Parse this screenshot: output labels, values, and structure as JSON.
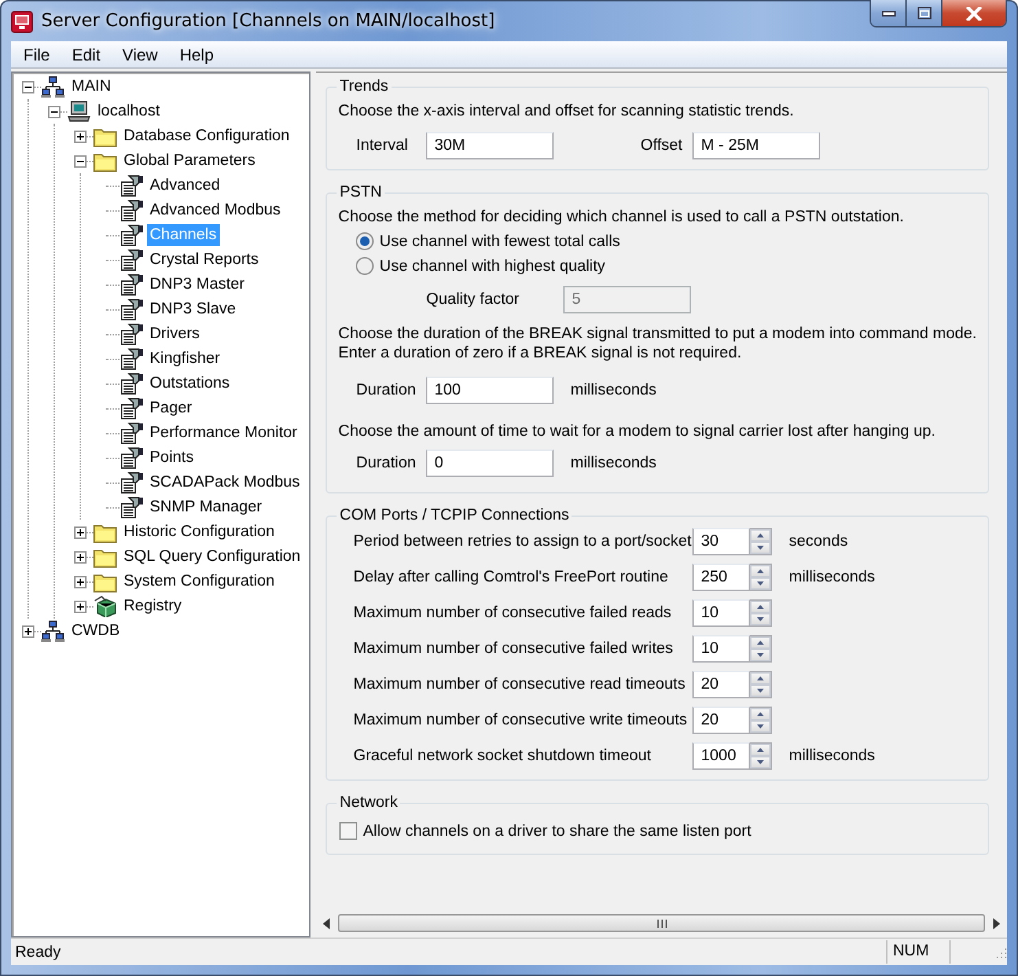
{
  "window": {
    "title": "Server Configuration [Channels on MAIN/localhost]"
  },
  "menu": [
    "File",
    "Edit",
    "View",
    "Help"
  ],
  "tree": [
    {
      "label": "MAIN",
      "kind": "network",
      "expanded": true,
      "selected": false,
      "children": [
        {
          "label": "localhost",
          "kind": "computer",
          "expanded": true,
          "selected": false,
          "children": [
            {
              "label": "Database Configuration",
              "kind": "folder",
              "expanded": false,
              "selected": false
            },
            {
              "label": "Global Parameters",
              "kind": "folder",
              "expanded": true,
              "selected": false,
              "children": [
                {
                  "label": "Advanced",
                  "kind": "page",
                  "selected": false
                },
                {
                  "label": "Advanced Modbus",
                  "kind": "page",
                  "selected": false
                },
                {
                  "label": "Channels",
                  "kind": "page",
                  "selected": true
                },
                {
                  "label": "Crystal Reports",
                  "kind": "page",
                  "selected": false
                },
                {
                  "label": "DNP3 Master",
                  "kind": "page",
                  "selected": false
                },
                {
                  "label": "DNP3 Slave",
                  "kind": "page",
                  "selected": false
                },
                {
                  "label": "Drivers",
                  "kind": "page",
                  "selected": false
                },
                {
                  "label": "Kingfisher",
                  "kind": "page",
                  "selected": false
                },
                {
                  "label": "Outstations",
                  "kind": "page",
                  "selected": false
                },
                {
                  "label": "Pager",
                  "kind": "page",
                  "selected": false
                },
                {
                  "label": "Performance Monitor",
                  "kind": "page",
                  "selected": false
                },
                {
                  "label": "Points",
                  "kind": "page",
                  "selected": false
                },
                {
                  "label": "SCADAPack Modbus",
                  "kind": "page",
                  "selected": false
                },
                {
                  "label": "SNMP Manager",
                  "kind": "page",
                  "selected": false
                }
              ]
            },
            {
              "label": "Historic Configuration",
              "kind": "folder",
              "expanded": false,
              "selected": false
            },
            {
              "label": "SQL Query Configuration",
              "kind": "folder",
              "expanded": false,
              "selected": false
            },
            {
              "label": "System Configuration",
              "kind": "folder",
              "expanded": false,
              "selected": false
            },
            {
              "label": "Registry",
              "kind": "registry",
              "expanded": false,
              "selected": false
            }
          ]
        }
      ]
    },
    {
      "label": "CWDB",
      "kind": "network",
      "expanded": false,
      "selected": false
    }
  ],
  "trends": {
    "title": "Trends",
    "description": "Choose the x-axis interval and offset for scanning statistic trends.",
    "interval": {
      "label": "Interval",
      "value": "30M"
    },
    "offset": {
      "label": "Offset",
      "value": "M - 25M"
    }
  },
  "pstn": {
    "title": "PSTN",
    "description": "Choose the method for deciding which channel is used to call a PSTN outstation.",
    "options": [
      {
        "label": "Use channel with fewest total calls",
        "selected": true
      },
      {
        "label": "Use channel with highest quality",
        "selected": false
      }
    ],
    "quality_factor": {
      "label": "Quality factor",
      "value": "5",
      "disabled": true
    },
    "break_description": [
      "Choose the duration of the BREAK signal transmitted to put a modem into command mode.",
      "Enter a duration of zero if a BREAK signal is not required."
    ],
    "break_duration": {
      "label": "Duration",
      "value": "100",
      "unit": "milliseconds"
    },
    "carrier_description": "Choose the amount of time to wait for a modem to signal carrier lost after hanging up.",
    "carrier_duration": {
      "label": "Duration",
      "value": "0",
      "unit": "milliseconds"
    }
  },
  "com_ports": {
    "title": "COM Ports / TCPIP Connections",
    "rows": [
      {
        "label": "Period between retries to assign to a port/socket",
        "value": "30",
        "unit": "seconds"
      },
      {
        "label": "Delay after calling Comtrol's FreePort routine",
        "value": "250",
        "unit": "milliseconds"
      },
      {
        "label": "Maximum number of consecutive failed reads",
        "value": "10"
      },
      {
        "label": "Maximum number of consecutive failed writes",
        "value": "10"
      },
      {
        "label": "Maximum number of consecutive read timeouts",
        "value": "20"
      },
      {
        "label": "Maximum number of consecutive write timeouts",
        "value": "20"
      },
      {
        "label": "Graceful network socket shutdown timeout",
        "value": "1000",
        "unit": "milliseconds"
      }
    ]
  },
  "network": {
    "title": "Network",
    "options": [
      {
        "label": "Allow channels on a driver to share the same listen port",
        "checked": false
      }
    ]
  },
  "status_bar": {
    "message": "Ready",
    "indicators": [
      "NUM"
    ]
  }
}
